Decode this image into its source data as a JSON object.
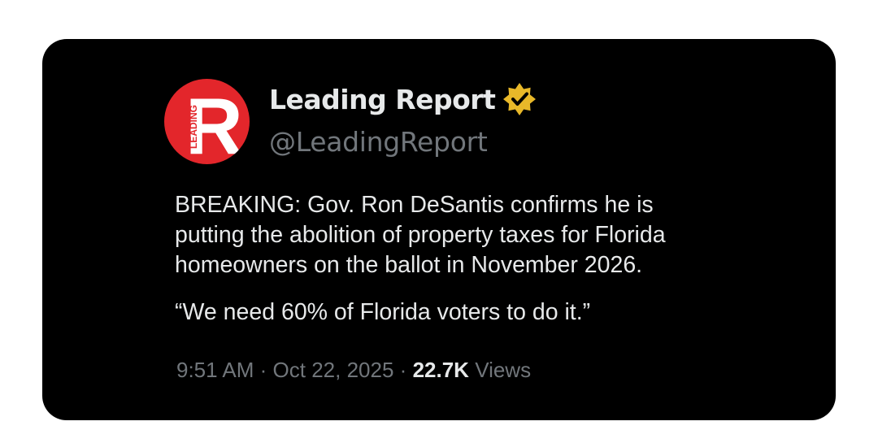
{
  "tweet": {
    "author": {
      "display_name": "Leading Report",
      "handle": "@LeadingReport",
      "verified": true,
      "avatar": {
        "icon": "leading-report-logo-icon",
        "letter": "R",
        "side_text": "LEADING",
        "color": "#e3262b"
      }
    },
    "paragraphs": [
      "BREAKING: Gov. Ron DeSantis confirms he is\nputting the abolition of property taxes for Florida\nhomeowners on the ballot in November 2026.",
      "“We need 60% of Florida voters to do it.”"
    ],
    "time": "9:51 AM",
    "date": "Oct 22, 2025",
    "views_count": "22.7K",
    "views_label": "Views",
    "separator": "·"
  },
  "colors": {
    "card_background": "#000000",
    "page_background": "#ffffff",
    "primary_text": "#e7e9ea",
    "secondary_text": "#71767b",
    "verified_badge": "#e8b829"
  }
}
